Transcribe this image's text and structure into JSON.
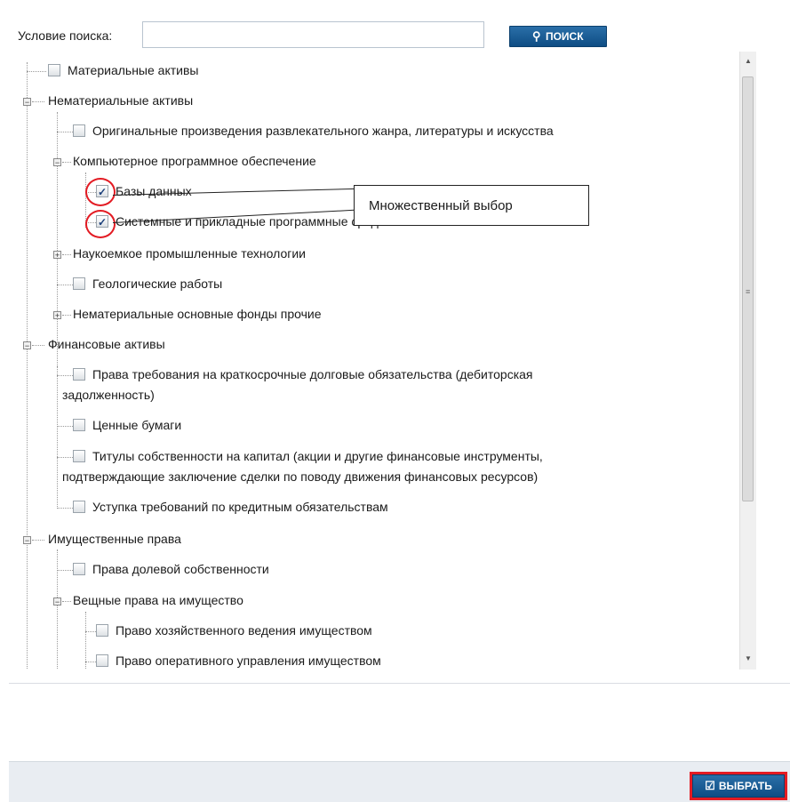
{
  "search": {
    "label": "Условие поиска:",
    "value": "",
    "placeholder": "",
    "button_label": "ПОИСК"
  },
  "tree": {
    "items": [
      {
        "label": "Материальные активы",
        "checked": false
      },
      {
        "label": "Нематериальные активы",
        "expanded": true
      },
      {
        "label": "Оригинальные произведения развлекательного жанра, литературы и искусства",
        "checked": false
      },
      {
        "label": "Компьютерное программное обеспечение",
        "expanded": true
      },
      {
        "label": "Базы данных",
        "checked": true
      },
      {
        "label": "Системные и прикладные программные средства",
        "checked": true
      },
      {
        "label": "Наукоемкое промышленные технологии",
        "expanded": false
      },
      {
        "label": "Геологические работы",
        "checked": false
      },
      {
        "label": "Нематериальные основные фонды прочие",
        "expanded": false
      },
      {
        "label": "Финансовые активы",
        "expanded": true
      },
      {
        "label": "Права требования на краткосрочные долговые обязательства (дебиторская",
        "label2": "задолженность)",
        "checked": false
      },
      {
        "label": "Ценные бумаги",
        "checked": false
      },
      {
        "label": "Титулы собственности на капитал (акции и другие финансовые инструменты,",
        "label2": "подтверждающие заключение сделки по поводу движения финансовых ресурсов)",
        "checked": false
      },
      {
        "label": "Уступка требований по кредитным обязательствам",
        "checked": false
      },
      {
        "label": "Имущественные права",
        "expanded": true
      },
      {
        "label": "Права долевой собственности",
        "checked": false
      },
      {
        "label": "Вещные права на имущество",
        "expanded": true
      },
      {
        "label": "Право хозяйственного ведения имуществом",
        "checked": false
      },
      {
        "label": "Право оперативного управления имуществом",
        "checked": false
      }
    ]
  },
  "annotation": {
    "callout_text": "Множественный выбор"
  },
  "footer": {
    "select_label": "ВЫБРАТЬ"
  },
  "colors": {
    "button_blue": "#0e4d84",
    "highlight_red": "#e31b23",
    "footer_bg": "#e9edf2"
  }
}
